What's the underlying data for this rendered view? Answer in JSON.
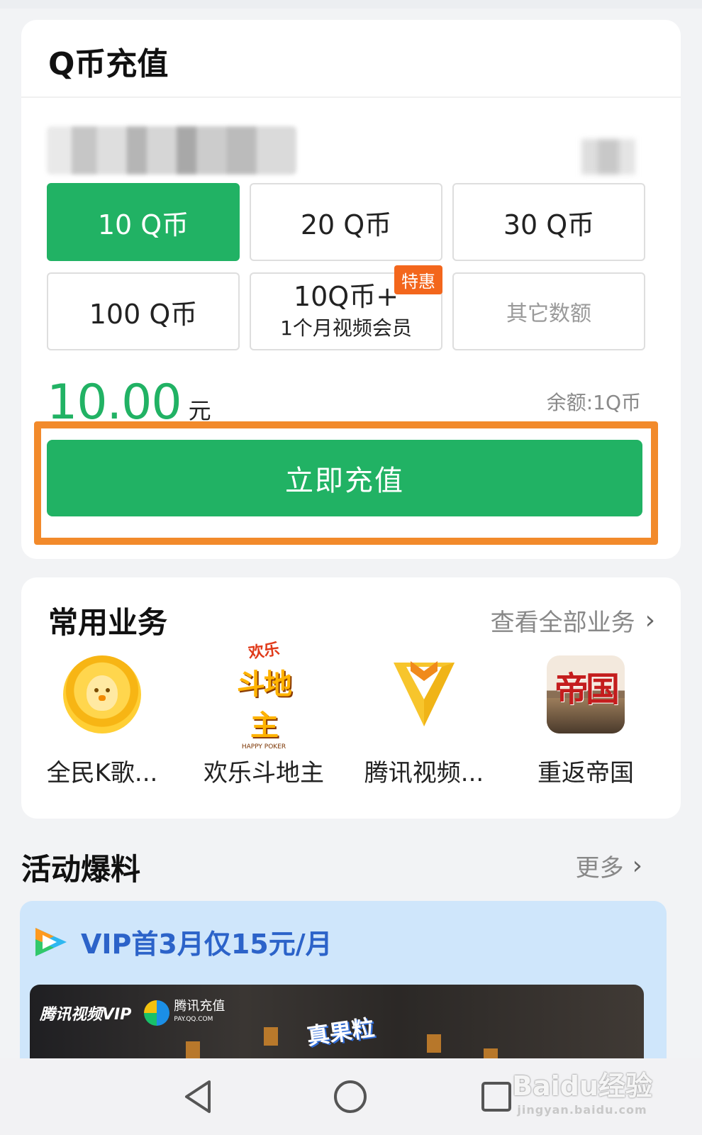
{
  "recharge": {
    "title": "Q币充值",
    "options": [
      {
        "label": "10 Q币",
        "selected": true
      },
      {
        "label": "20 Q币"
      },
      {
        "label": "30 Q币"
      },
      {
        "label": "100 Q币"
      },
      {
        "line1": "10Q币+",
        "line2": "1个月视频会员",
        "badge": "特惠"
      },
      {
        "label": "其它数额"
      }
    ],
    "amount_value": "10.00",
    "amount_unit": "元",
    "balance": "余额:1Q币",
    "submit_label": "立即充值"
  },
  "services": {
    "title": "常用业务",
    "view_all": "查看全部业务",
    "items": [
      {
        "label": "全民K歌...",
        "icon": "karaoke-icon"
      },
      {
        "label": "欢乐斗地主",
        "icon": "happy-poker-icon",
        "icon_text": "欢乐",
        "icon_text2": "斗地主",
        "icon_text3": "HAPPY POKER"
      },
      {
        "label": "腾讯视频...",
        "icon": "tencent-video-icon"
      },
      {
        "label": "重返帝国",
        "icon": "empire-icon",
        "icon_text": "帝国"
      }
    ]
  },
  "activity": {
    "title": "活动爆料",
    "more": "更多",
    "promo_title": "VIP首3月仅15元/月",
    "banner_vip": "腾讯视频VIP",
    "banner_pay": "腾讯充值",
    "banner_pay_sub": "PAY.QQ.COM",
    "banner_product": "真果粒"
  },
  "watermark": {
    "main": "Baidu经验",
    "sub": "jingyan.baidu.com"
  },
  "colors": {
    "accent": "#21b264",
    "highlight": "#f28a2b",
    "badge": "#f3661c",
    "promo_bg": "#cfe6fb"
  }
}
